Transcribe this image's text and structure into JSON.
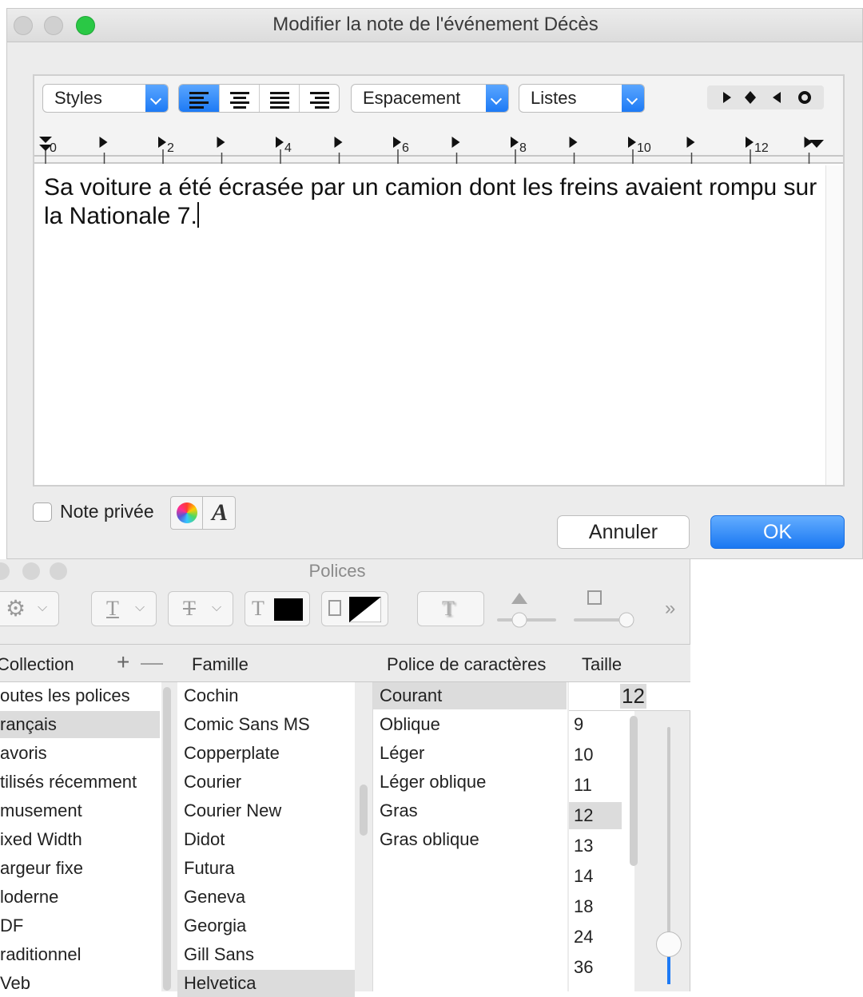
{
  "dialog": {
    "title": "Modifier la note de l'événement Décès",
    "styles_label": "Styles",
    "spacing_label": "Espacement",
    "lists_label": "Listes",
    "ruler_numbers": [
      "0",
      "2",
      "4",
      "6",
      "8",
      "10",
      "12"
    ],
    "note_text": "Sa voiture a été écrasée par un camion dont les freins avaient rompu sur la Nationale 7.",
    "private_note_label": "Note privée",
    "cancel_label": "Annuler",
    "ok_label": "OK",
    "accent_color": "#1d7af5"
  },
  "fonts_panel": {
    "title": "Polices",
    "collection_header": "Collection",
    "family_header": "Famille",
    "typeface_header": "Police de caractères",
    "size_header": "Taille",
    "collections": [
      "outes les polices",
      "rançais",
      "avoris",
      "tilisés récemment",
      "musement",
      "ixed Width",
      "argeur fixe",
      "loderne",
      "DF",
      "raditionnel",
      "Veb"
    ],
    "families": [
      "Cochin",
      "Comic Sans MS",
      "Copperplate",
      "Courier",
      "Courier New",
      "Didot",
      "Futura",
      "Geneva",
      "Georgia",
      "Gill Sans",
      "Helvetica"
    ],
    "typefaces": [
      "Courant",
      "Oblique",
      "Léger",
      "Léger oblique",
      "Gras",
      "Gras oblique"
    ],
    "size_value": "12",
    "sizes": [
      "9",
      "10",
      "11",
      "12",
      "13",
      "14",
      "18",
      "24",
      "36"
    ]
  }
}
